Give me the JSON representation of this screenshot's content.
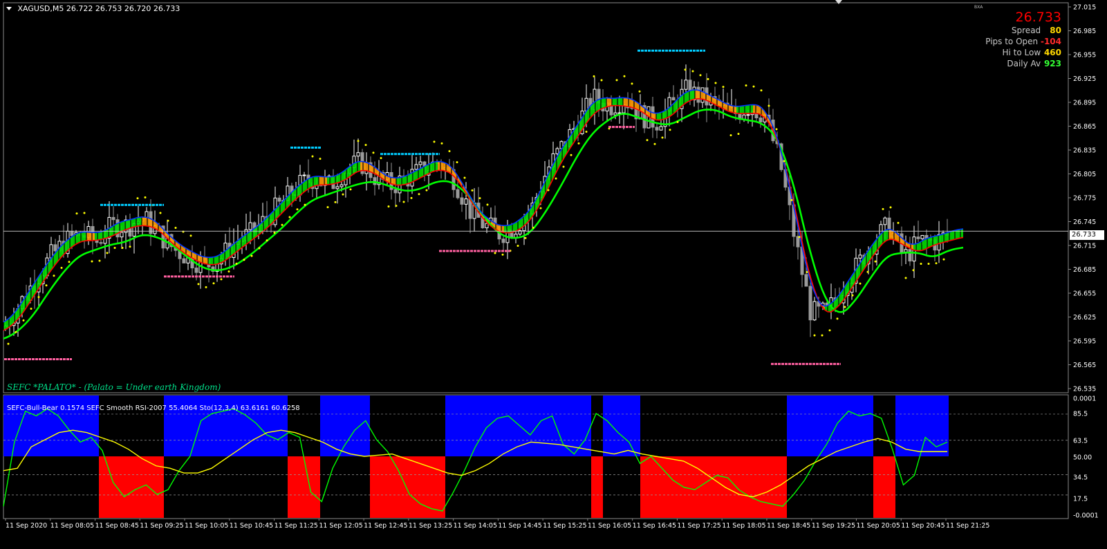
{
  "header": {
    "symbol": "XAGUSD,M5",
    "ohlc": "26.722 26.753 26.720 26.733",
    "indicator_header": "SEFC-Bull-Bear 0.1574  SEFC Smooth RSI-2007 55.4064  Sto(12,3,4) 63.6161 60.6258",
    "corner_tag": "BXA"
  },
  "info_panel": {
    "price": "26.733",
    "rows": [
      {
        "label": "Spread",
        "value": "80",
        "color": "#ffd700"
      },
      {
        "label": "Pips to Open",
        "value": "-104",
        "color": "#ff2a2a"
      },
      {
        "label": "Hi to Low",
        "value": "460",
        "color": "#ffd700"
      },
      {
        "label": "Daily Av",
        "value": "923",
        "color": "#33ff33"
      }
    ]
  },
  "caption": "SEFC *PALATO* - (Palato = Under earth Kingdom)",
  "current_price_label": "26.733",
  "colors": {
    "bull_candle": "#ffffff",
    "bear_candle": "#9a9a9a",
    "green_line": "#00ff00",
    "red_line": "#ff0000",
    "blue_line": "#0033ff",
    "bull_fill": "#00dd00",
    "bear_fill": "#ff9900",
    "dots": "#ffff00",
    "resistance": "#00ccff",
    "support": "#ff5fa0",
    "panel_blue": "#0000ff",
    "panel_red": "#ff0000",
    "rsi_line": "#ffff00",
    "sto_line": "#00ff00"
  },
  "chart_data": [
    {
      "type": "candlestick",
      "symbol": "XAGUSD",
      "timeframe": "M5",
      "yaxis": {
        "ticks": [
          "27.015",
          "26.985",
          "26.955",
          "26.925",
          "26.895",
          "26.865",
          "26.835",
          "26.805",
          "26.775",
          "26.745",
          "26.715",
          "26.685",
          "26.655",
          "26.625",
          "26.595",
          "26.565",
          "26.535"
        ],
        "range": [
          26.535,
          27.015
        ]
      },
      "xaxis": {
        "ticks": [
          "11 Sep 2020",
          "11 Sep 08:05",
          "11 Sep 08:45",
          "11 Sep 09:25",
          "11 Sep 10:05",
          "11 Sep 10:45",
          "11 Sep 11:25",
          "11 Sep 12:05",
          "11 Sep 12:45",
          "11 Sep 13:25",
          "11 Sep 14:05",
          "11 Sep 14:45",
          "11 Sep 15:25",
          "11 Sep 16:05",
          "11 Sep 16:45",
          "11 Sep 17:25",
          "11 Sep 18:05",
          "11 Sep 18:45",
          "11 Sep 19:25",
          "11 Sep 20:05",
          "11 Sep 20:45",
          "11 Sep 21:25"
        ]
      },
      "close_path": [
        26.61,
        26.64,
        26.67,
        26.7,
        26.72,
        26.73,
        26.72,
        26.74,
        26.74,
        26.75,
        26.73,
        26.71,
        26.7,
        26.69,
        26.7,
        26.72,
        26.73,
        26.75,
        26.77,
        26.79,
        26.8,
        26.79,
        26.81,
        26.82,
        26.8,
        26.79,
        26.8,
        26.81,
        26.82,
        26.8,
        26.76,
        26.74,
        26.73,
        26.74,
        26.76,
        26.81,
        26.84,
        26.87,
        26.9,
        26.89,
        26.9,
        26.88,
        26.87,
        26.89,
        26.91,
        26.9,
        26.89,
        26.88,
        26.89,
        26.88,
        26.82,
        26.72,
        26.63,
        26.63,
        26.66,
        26.69,
        26.72,
        26.74,
        26.7,
        26.72,
        26.72,
        26.73
      ],
      "current_price": 26.733,
      "resistance_levels": [
        26.766,
        26.838,
        26.83,
        26.96
      ],
      "support_levels": [
        26.572,
        26.676,
        26.708,
        26.864,
        26.566
      ]
    },
    {
      "type": "oscillator",
      "yaxis": {
        "ticks": [
          "0.0001",
          "85.5",
          "63.5",
          "50.00",
          "34.5",
          "17.5",
          "-0.0001"
        ]
      },
      "regimes": [
        "bull",
        "bear",
        "bull",
        "bear",
        "bull",
        "bear",
        "bull",
        "bear",
        "bull",
        "bear",
        "bull",
        "bear",
        "bull"
      ],
      "sto_path": [
        8,
        62,
        88,
        84,
        90,
        84,
        72,
        62,
        66,
        55,
        28,
        16,
        22,
        26,
        18,
        22,
        38,
        50,
        80,
        86,
        88,
        90,
        85,
        78,
        68,
        64,
        70,
        66,
        20,
        12,
        40,
        58,
        72,
        80,
        64,
        54,
        38,
        18,
        10,
        6,
        4,
        20,
        38,
        58,
        74,
        82,
        84,
        76,
        68,
        80,
        84,
        60,
        52,
        64,
        86,
        80,
        70,
        62,
        44,
        50,
        40,
        30,
        24,
        22,
        28,
        34,
        32,
        22,
        16,
        12,
        10,
        8,
        18,
        30,
        46,
        60,
        78,
        88,
        84,
        86,
        82,
        56,
        26,
        34,
        66,
        58,
        62
      ],
      "rsi_path": [
        38,
        40,
        58,
        64,
        70,
        72,
        70,
        66,
        62,
        56,
        48,
        42,
        40,
        36,
        36,
        40,
        48,
        56,
        64,
        70,
        72,
        70,
        66,
        62,
        56,
        52,
        50,
        51,
        52,
        48,
        44,
        40,
        36,
        34,
        38,
        44,
        52,
        58,
        62,
        61,
        60,
        58,
        56,
        54,
        52,
        55,
        52,
        50,
        48,
        46,
        40,
        32,
        24,
        18,
        16,
        20,
        26,
        34,
        42,
        48,
        54,
        58,
        62,
        65,
        62,
        56,
        54,
        54,
        54
      ]
    }
  ]
}
